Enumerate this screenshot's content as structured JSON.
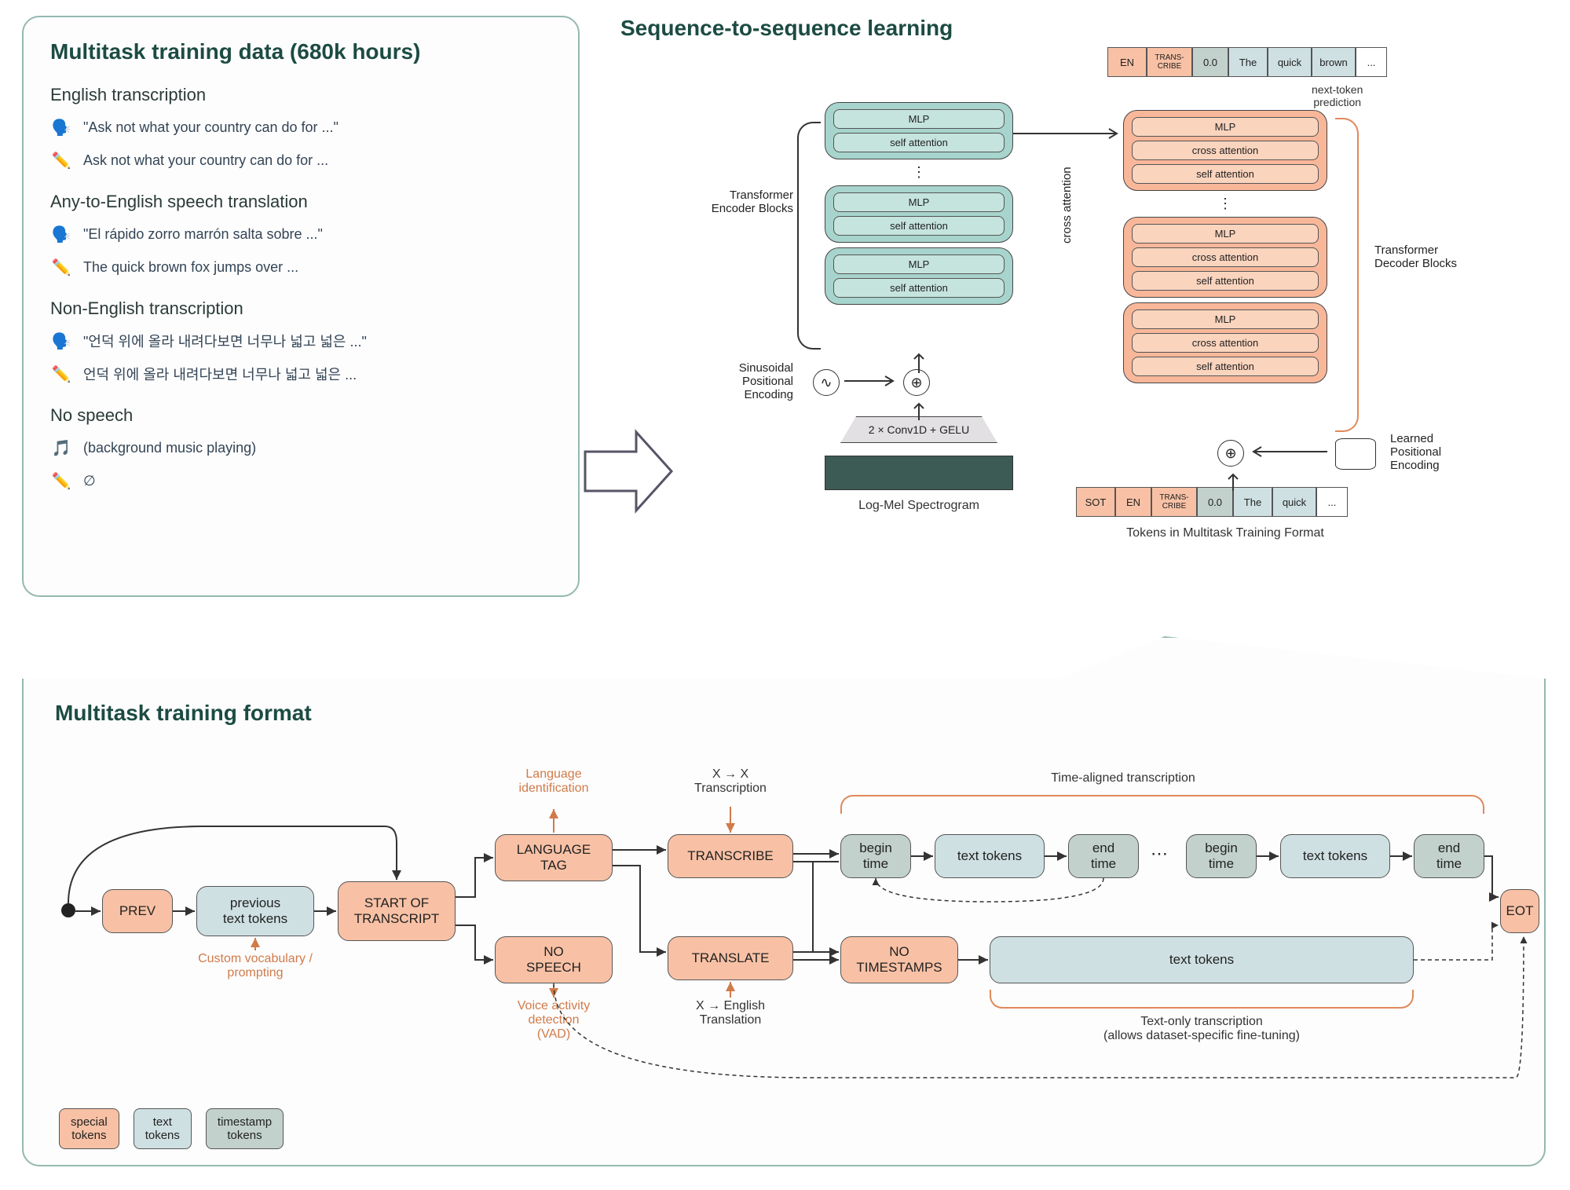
{
  "top": {
    "data_title": "Multitask training data (680k hours)",
    "sec1": {
      "heading": "English transcription",
      "audio": "\"Ask not what your country can do for ...\"",
      "text": "Ask not what your country can do for ..."
    },
    "sec2": {
      "heading": "Any-to-English speech translation",
      "audio": "\"El rápido zorro marrón salta sobre ...\"",
      "text": "The quick brown fox jumps over ..."
    },
    "sec3": {
      "heading": "Non-English transcription",
      "audio": "\"언덕 위에 올라 내려다보면 너무나 넓고 넓은 ...\"",
      "text": "언덕 위에 올라 내려다보면 너무나 넓고 넓은 ..."
    },
    "sec4": {
      "heading": "No speech",
      "audio": "(background music playing)",
      "text": "∅"
    }
  },
  "seq": {
    "title": "Sequence-to-sequence learning",
    "encoder_label": "Transformer\nEncoder Blocks",
    "decoder_label": "Transformer\nDecoder Blocks",
    "pe_sin": "Sinusoidal\nPositional\nEncoding",
    "pe_learn": "Learned\nPositional\nEncoding",
    "cross": "cross attention",
    "conv": "2 × Conv1D + GELU",
    "logmel": "Log-Mel Spectrogram",
    "inputs_label": "Tokens in Multitask Training Format",
    "next_pred": "next-token\nprediction",
    "block": {
      "mlp": "MLP",
      "self": "self attention",
      "crossa": "cross attention"
    },
    "out_tokens": [
      "EN",
      "TRANS-\nCRIBE",
      "0.0",
      "The",
      "quick",
      "brown",
      "..."
    ],
    "in_tokens": [
      "SOT",
      "EN",
      "TRANS-\nCRIBE",
      "0.0",
      "The",
      "quick",
      "..."
    ]
  },
  "format": {
    "title": "Multitask training format",
    "prev": "PREV",
    "prev_tokens": "previous\ntext tokens",
    "custom_prompt": "Custom vocabulary /\nprompting",
    "sot": "START OF\nTRANSCRIPT",
    "lang_tag": "LANGUAGE\nTAG",
    "lang_id": "Language\nidentification",
    "no_speech": "NO\nSPEECH",
    "vad": "Voice activity\ndetection\n(VAD)",
    "transcribe": "TRANSCRIBE",
    "x2x": "X → X\nTranscription",
    "translate": "TRANSLATE",
    "x2en": "X → English\nTranslation",
    "begin": "begin\ntime",
    "end": "end\ntime",
    "text_tokens": "text tokens",
    "no_ts": "NO\nTIMESTAMPS",
    "time_aligned": "Time-aligned transcription",
    "text_only": "Text-only transcription\n(allows dataset-specific fine-tuning)",
    "eot": "EOT",
    "legend": {
      "special": "special\ntokens",
      "text": "text\ntokens",
      "ts": "timestamp\ntokens"
    }
  }
}
